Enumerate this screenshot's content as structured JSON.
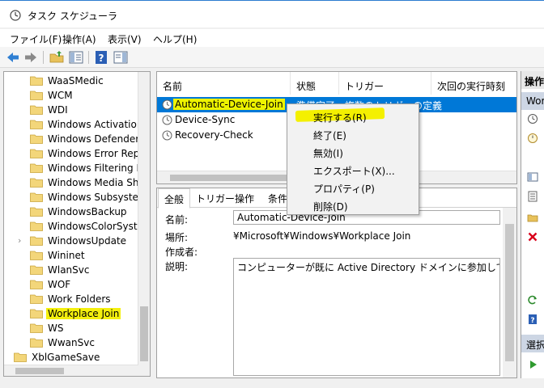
{
  "window": {
    "title": "タスク スケジューラ"
  },
  "menu": [
    "ファイル(F)",
    "操作(A)",
    "表示(V)",
    "ヘルプ(H)"
  ],
  "tree": {
    "items": [
      {
        "label": "WaaSMedic"
      },
      {
        "label": "WCM"
      },
      {
        "label": "WDI"
      },
      {
        "label": "Windows Activation"
      },
      {
        "label": "Windows Defender"
      },
      {
        "label": "Windows Error Repo"
      },
      {
        "label": "Windows Filtering Pl"
      },
      {
        "label": "Windows Media Sha"
      },
      {
        "label": "Windows Subsystem"
      },
      {
        "label": "WindowsBackup"
      },
      {
        "label": "WindowsColorSyster"
      },
      {
        "label": "WindowsUpdate",
        "expander": "›"
      },
      {
        "label": "Wininet"
      },
      {
        "label": "WlanSvc"
      },
      {
        "label": "WOF"
      },
      {
        "label": "Work Folders"
      },
      {
        "label": "Workplace Join",
        "selected": true
      },
      {
        "label": "WS"
      },
      {
        "label": "WwanSvc"
      },
      {
        "label": "XblGameSave"
      }
    ]
  },
  "task_list": {
    "columns": [
      "名前",
      "状態",
      "トリガー",
      "次回の実行時刻"
    ],
    "rows": [
      {
        "name": "Automatic-Device-Join",
        "status": "準備完了",
        "trigger": "複数のトリガーの定義",
        "selected": true
      },
      {
        "name": "Device-Sync",
        "status": "",
        "trigger": ""
      },
      {
        "name": "Recovery-Check",
        "status": "",
        "trigger": ""
      }
    ]
  },
  "context_menu": {
    "items": [
      "実行する(R)",
      "終了(E)",
      "無効(I)",
      "エクスポート(X)...",
      "プロパティ(P)",
      "削除(D)"
    ]
  },
  "detail": {
    "tabs": [
      "全般",
      "トリガー",
      "操作",
      "条件"
    ],
    "name_label": "名前:",
    "name_value": "Automatic-Device-Join",
    "location_label": "場所:",
    "location_value": "¥Microsoft¥Windows¥Workplace Join",
    "author_label": "作成者:",
    "author_value": "",
    "description_label": "説明:",
    "description_value": "コンピューターが既に Active Directory ドメインに参加している場合("
  },
  "actions": {
    "header": "操作",
    "section_top": "Wor",
    "section_selected": "選択"
  },
  "colors": {
    "selection": "#0078d7",
    "highlight": "#f4f000",
    "delete": "#d9001b"
  }
}
